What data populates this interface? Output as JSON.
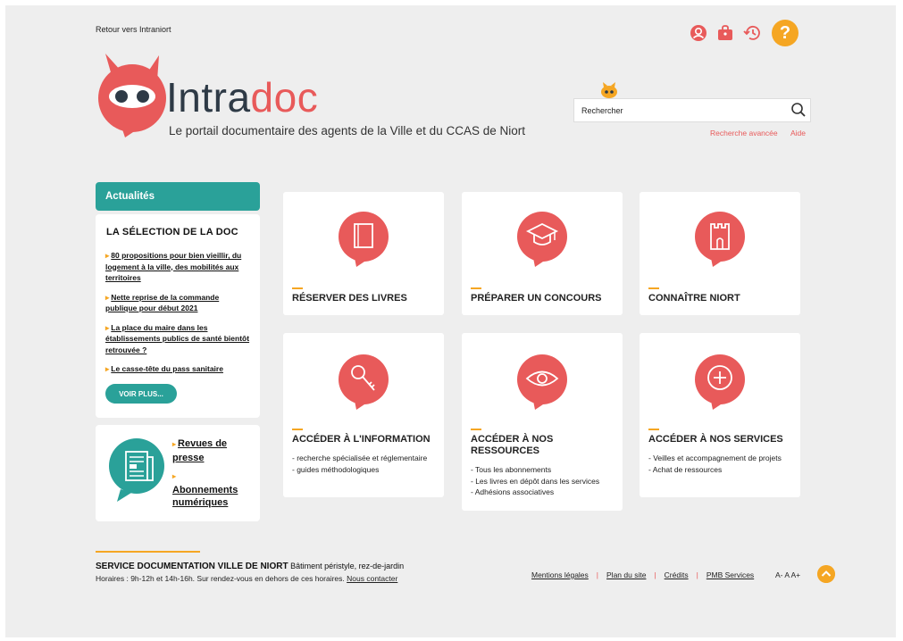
{
  "header": {
    "back_link": "Retour vers Intraniort",
    "logo_part1": "Intra",
    "logo_part2": "doc",
    "tagline": "Le portail documentaire des agents de la Ville et du CCAS de Niort",
    "help_button": "?",
    "icons": [
      "user-icon",
      "basket-icon",
      "history-icon",
      "help-icon"
    ]
  },
  "search": {
    "value": "Rechercher",
    "advanced": "Recherche avancée",
    "help": "Aide"
  },
  "news": {
    "header": "Actualités",
    "title": "LA SÉLECTION DE LA DOC",
    "items": [
      "80 propositions pour bien vieillir, du logement à la ville, des mobilités aux territoires",
      "Nette reprise de la commande publique pour début 2021",
      "La place du maire dans les établissements publics de santé bientôt retrouvée ?",
      "Le casse-tête du pass sanitaire"
    ],
    "more_button": "VOIR PLUS..."
  },
  "press": {
    "link1": "Revues de presse",
    "link2": "Abonnements numériques"
  },
  "tiles": [
    {
      "title": "RÉSERVER DES LIVRES",
      "icon": "book-icon",
      "lines": []
    },
    {
      "title": "PRÉPARER UN CONCOURS",
      "icon": "graduation-cap-icon",
      "lines": []
    },
    {
      "title": "CONNAÎTRE NIORT",
      "icon": "tower-icon",
      "lines": []
    },
    {
      "title": "ACCÉDER À L'INFORMATION",
      "icon": "key-icon",
      "lines": [
        "- recherche spécialisée et réglementaire",
        "- guides méthodologiques"
      ]
    },
    {
      "title": "ACCÉDER À NOS RESSOURCES",
      "icon": "eye-icon",
      "lines": [
        "- Tous les abonnements",
        "- Les livres en dépôt dans les services",
        "- Adhésions associatives"
      ]
    },
    {
      "title": "ACCÉDER À NOS SERVICES",
      "icon": "plus-circle-icon",
      "lines": [
        "- Veilles et accompagnement de projets",
        "- Achat de ressources"
      ]
    }
  ],
  "footer": {
    "org_name": "SERVICE DOCUMENTATION VILLE DE NIORT",
    "address": " Bâtiment péristyle, rez-de-jardin",
    "hours": "Horaires : 9h-12h et 14h-16h. Sur rendez-vous en dehors de ces horaires. ",
    "contact": "Nous contacter",
    "links": [
      "Mentions légales",
      "Plan du site",
      "Crédits",
      "PMB Services"
    ],
    "font_sizes": "A- A A+"
  },
  "colors": {
    "accent_red": "#e85a5a",
    "teal": "#2aa199",
    "orange": "#f5a623",
    "background": "#eeeeee"
  }
}
